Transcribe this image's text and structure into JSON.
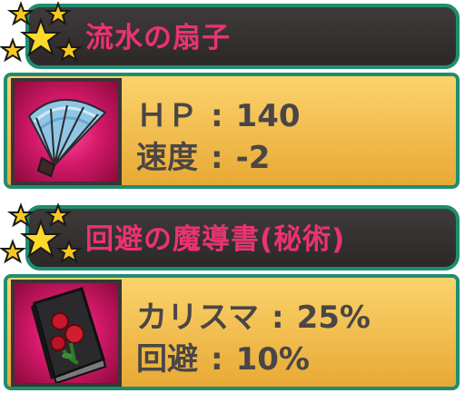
{
  "items": [
    {
      "name": "流水の扇子",
      "rarity_stars": 5,
      "icon": "fan-icon",
      "stats": [
        {
          "label": "ＨＰ",
          "sep": ":",
          "value": "140"
        },
        {
          "label": "速度",
          "sep": ":",
          "value": "-2"
        }
      ]
    },
    {
      "name": "回避の魔導書(秘術)",
      "rarity_stars": 5,
      "icon": "grimoire-icon",
      "stats": [
        {
          "label": "カリスマ",
          "sep": ":",
          "value": "25%"
        },
        {
          "label": "回避",
          "sep": ":",
          "value": "10%"
        }
      ]
    }
  ]
}
